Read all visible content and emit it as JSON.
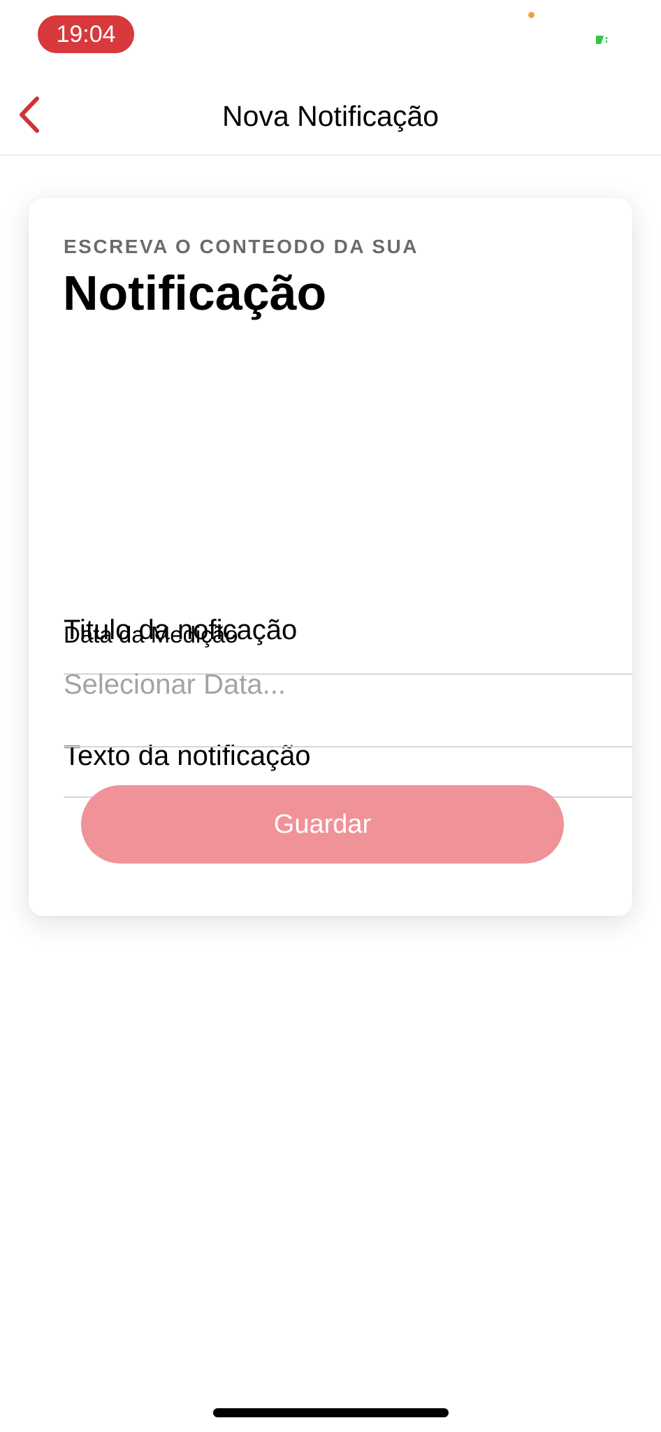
{
  "status_bar": {
    "time": "19:04",
    "accent_color": "#d8393c"
  },
  "nav": {
    "back_icon": "chevron-left-icon",
    "title": "Nova Notificação",
    "accent_color": "#d0323a"
  },
  "card": {
    "subtitle": "ESCREVA O CONTEODO DA SUA",
    "title": "Notificação"
  },
  "form": {
    "title_field": {
      "value": "Titulo da noficação"
    },
    "text_field": {
      "value": "Texto da notificação"
    },
    "date_field": {
      "label": "Data da Medição",
      "placeholder": "Selecionar Data..."
    },
    "save_button": {
      "label": "Guardar",
      "color": "#ef9398"
    }
  }
}
